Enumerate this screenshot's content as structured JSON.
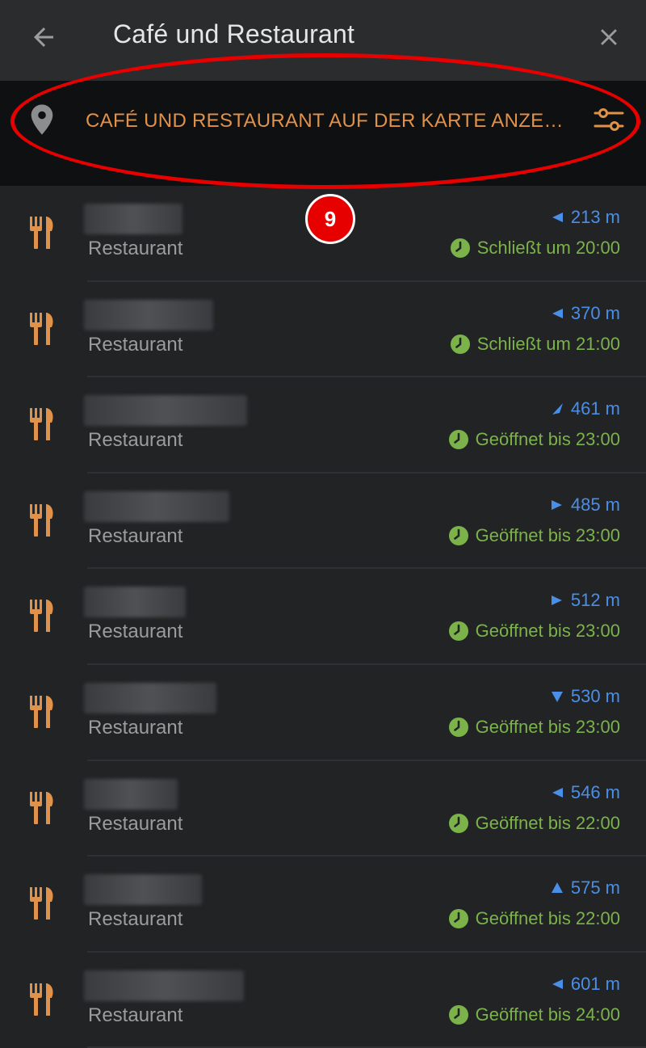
{
  "header": {
    "title": "Café und Restaurant",
    "back_icon": "arrow-left-icon",
    "close_icon": "close-icon"
  },
  "mapbar": {
    "label": "CAFÉ UND RESTAURANT AUF DER KARTE ANZE…",
    "pin_icon": "location-pin-icon",
    "filter_icon": "filter-sliders-icon"
  },
  "annotation": {
    "badge": "9",
    "color": "#e60000"
  },
  "colors": {
    "accent_orange": "#e0914a",
    "distance_blue": "#4a8fe7",
    "open_green": "#7bb34a"
  },
  "results": [
    {
      "category": "Restaurant",
      "distance": "213 m",
      "direction": "left",
      "hours": "Schließt um 20:00"
    },
    {
      "category": "Restaurant",
      "distance": "370 m",
      "direction": "left",
      "hours": "Schließt um 21:00"
    },
    {
      "category": "Restaurant",
      "distance": "461 m",
      "direction": "up-right",
      "hours": "Geöffnet bis 23:00"
    },
    {
      "category": "Restaurant",
      "distance": "485 m",
      "direction": "right",
      "hours": "Geöffnet bis 23:00"
    },
    {
      "category": "Restaurant",
      "distance": "512 m",
      "direction": "right",
      "hours": "Geöffnet bis 23:00"
    },
    {
      "category": "Restaurant",
      "distance": "530 m",
      "direction": "down",
      "hours": "Geöffnet bis 23:00"
    },
    {
      "category": "Restaurant",
      "distance": "546 m",
      "direction": "left",
      "hours": "Geöffnet bis 22:00"
    },
    {
      "category": "Restaurant",
      "distance": "575 m",
      "direction": "up",
      "hours": "Geöffnet bis 22:00"
    },
    {
      "category": "Restaurant",
      "distance": "601 m",
      "direction": "left",
      "hours": "Geöffnet bis 24:00"
    }
  ]
}
